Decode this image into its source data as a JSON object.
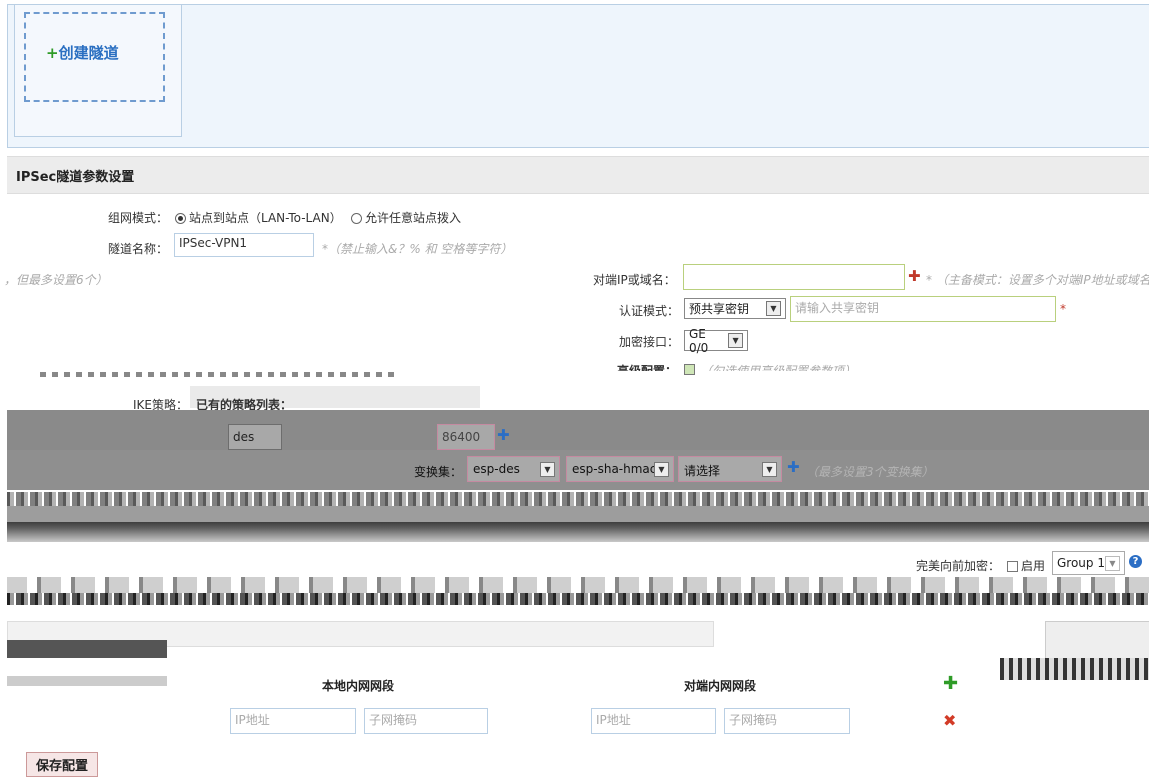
{
  "create": {
    "plus_icon": "+",
    "label": "创建隧道"
  },
  "section": {
    "title": "IPSec隧道参数设置"
  },
  "network_mode": {
    "label": "组网模式：",
    "option1": "站点到站点（LAN-To-LAN）",
    "option2": "允许任意站点拨入"
  },
  "tunnel_name": {
    "label": "隧道名称：",
    "value": "IPSec-VPN1",
    "hint": "*（禁止输入&？% 和 空格等字符）"
  },
  "left_hint": "，但最多设置6个）",
  "peer": {
    "label": "对端IP或域名：",
    "value": "",
    "hint": "*  （主备模式：设置多个对端IP地址或域名"
  },
  "auth": {
    "label": "认证模式：",
    "value": "预共享密钥",
    "placeholder": "请输入共享密钥",
    "required": "*"
  },
  "encrypt_iface": {
    "label": "加密接口：",
    "value": "GE 0/0"
  },
  "advanced": {
    "label": "高级配置：",
    "hint": "（勾选使用高级配置参数项）"
  },
  "ike": {
    "label": "IKE策略：",
    "list_label": "已有的策略列表："
  },
  "ike_row": {
    "enc": "des",
    "num": "86400"
  },
  "transform": {
    "label": "变换集：",
    "enc": "esp-des",
    "hash": "esp-sha-hmac",
    "select": "请选择",
    "hint": "（最多设置3个变换集）"
  },
  "pfs": {
    "label": "完美向前加密：",
    "enable": "启用",
    "group": "Group 1"
  },
  "table": {
    "local_header": "本地内网网段",
    "remote_header": "对端内网网段",
    "ip_placeholder": "IP地址",
    "mask_placeholder": "子网掩码"
  },
  "save": {
    "label": "保存配置"
  },
  "colors": {
    "accent": "#2a6fc1",
    "add": "#2e9b27",
    "remove": "#d23b27",
    "help": "#2b6ec5"
  }
}
